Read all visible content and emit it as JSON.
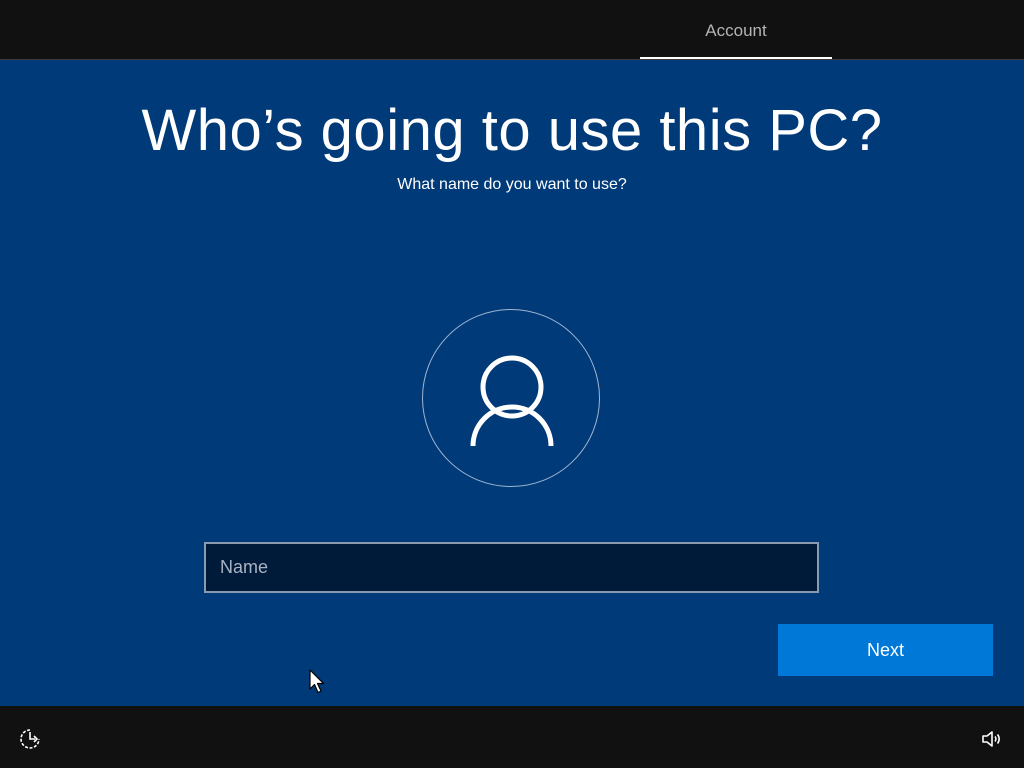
{
  "header": {
    "step_label": "Account"
  },
  "main": {
    "title": "Who’s going to use this PC?",
    "subtitle": "What name do you want to use?",
    "avatar_icon": "user-icon",
    "name_field": {
      "placeholder": "Name",
      "value": ""
    },
    "next_label": "Next"
  },
  "footer": {
    "left_icon": "ease-of-access-icon",
    "right_icon": "volume-icon"
  },
  "colors": {
    "background": "#003a78",
    "bars": "#111111",
    "accent": "#0078d7",
    "input_bg": "#001a3a"
  }
}
